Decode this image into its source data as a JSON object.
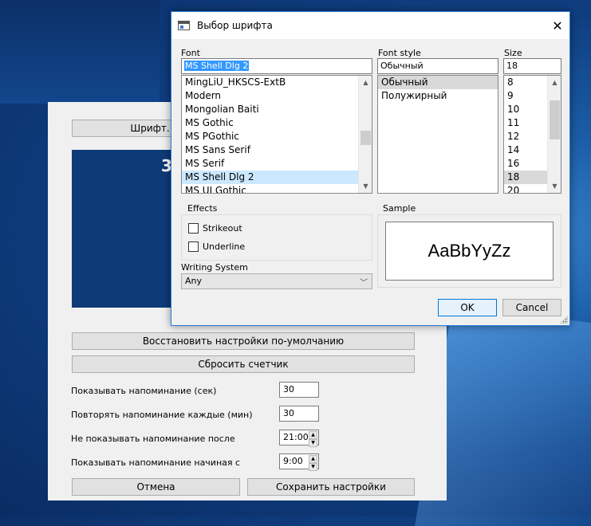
{
  "settings_window": {
    "font_button": "Шрифт..",
    "preview_text": "3",
    "restore_defaults": "Восстановить настройки по-умолчанию",
    "reset_counter": "Сбросить счетчик",
    "show_reminder_label": "Показывать напоминание (сек)",
    "show_reminder_value": "30",
    "repeat_reminder_label": "Повторять напоминание каждые (мин)",
    "repeat_reminder_value": "30",
    "dont_show_after_label": "Не показывать напоминание после",
    "dont_show_after_value": "21:00",
    "show_from_label": "Показывать напоминание начиная с",
    "show_from_value": "9:00",
    "cancel": "Отмена",
    "save": "Сохранить настройки"
  },
  "font_dialog": {
    "title": "Выбор шрифта",
    "font_label": "Font",
    "font_value": "MS Shell Dlg 2",
    "font_list": [
      "MingLiU_HKSCS-ExtB",
      "Modern",
      "Mongolian Baiti",
      "MS Gothic",
      "MS PGothic",
      "MS Sans Serif",
      "MS Serif",
      "MS Shell Dlg 2",
      "MS UI Gothic"
    ],
    "font_selected_index": 7,
    "style_label": "Font style",
    "style_value": "Обычный",
    "style_list": [
      "Обычный",
      "Полужирный"
    ],
    "style_selected_index": 0,
    "size_label": "Size",
    "size_value": "18",
    "size_list": [
      "8",
      "9",
      "10",
      "11",
      "12",
      "14",
      "16",
      "18",
      "20"
    ],
    "size_selected_index": 7,
    "effects_label": "Effects",
    "strikeout_label": "Strikeout",
    "strikeout_checked": false,
    "underline_label": "Underline",
    "underline_checked": false,
    "writing_system_label": "Writing System",
    "writing_system_value": "Any",
    "sample_label": "Sample",
    "sample_text": "AaBbYyZz",
    "ok": "OK",
    "cancel": "Cancel"
  },
  "icons": {
    "close": "close-icon",
    "app": "window-icon",
    "scroll_up": "chevron-up-icon",
    "scroll_down": "chevron-down-icon"
  }
}
